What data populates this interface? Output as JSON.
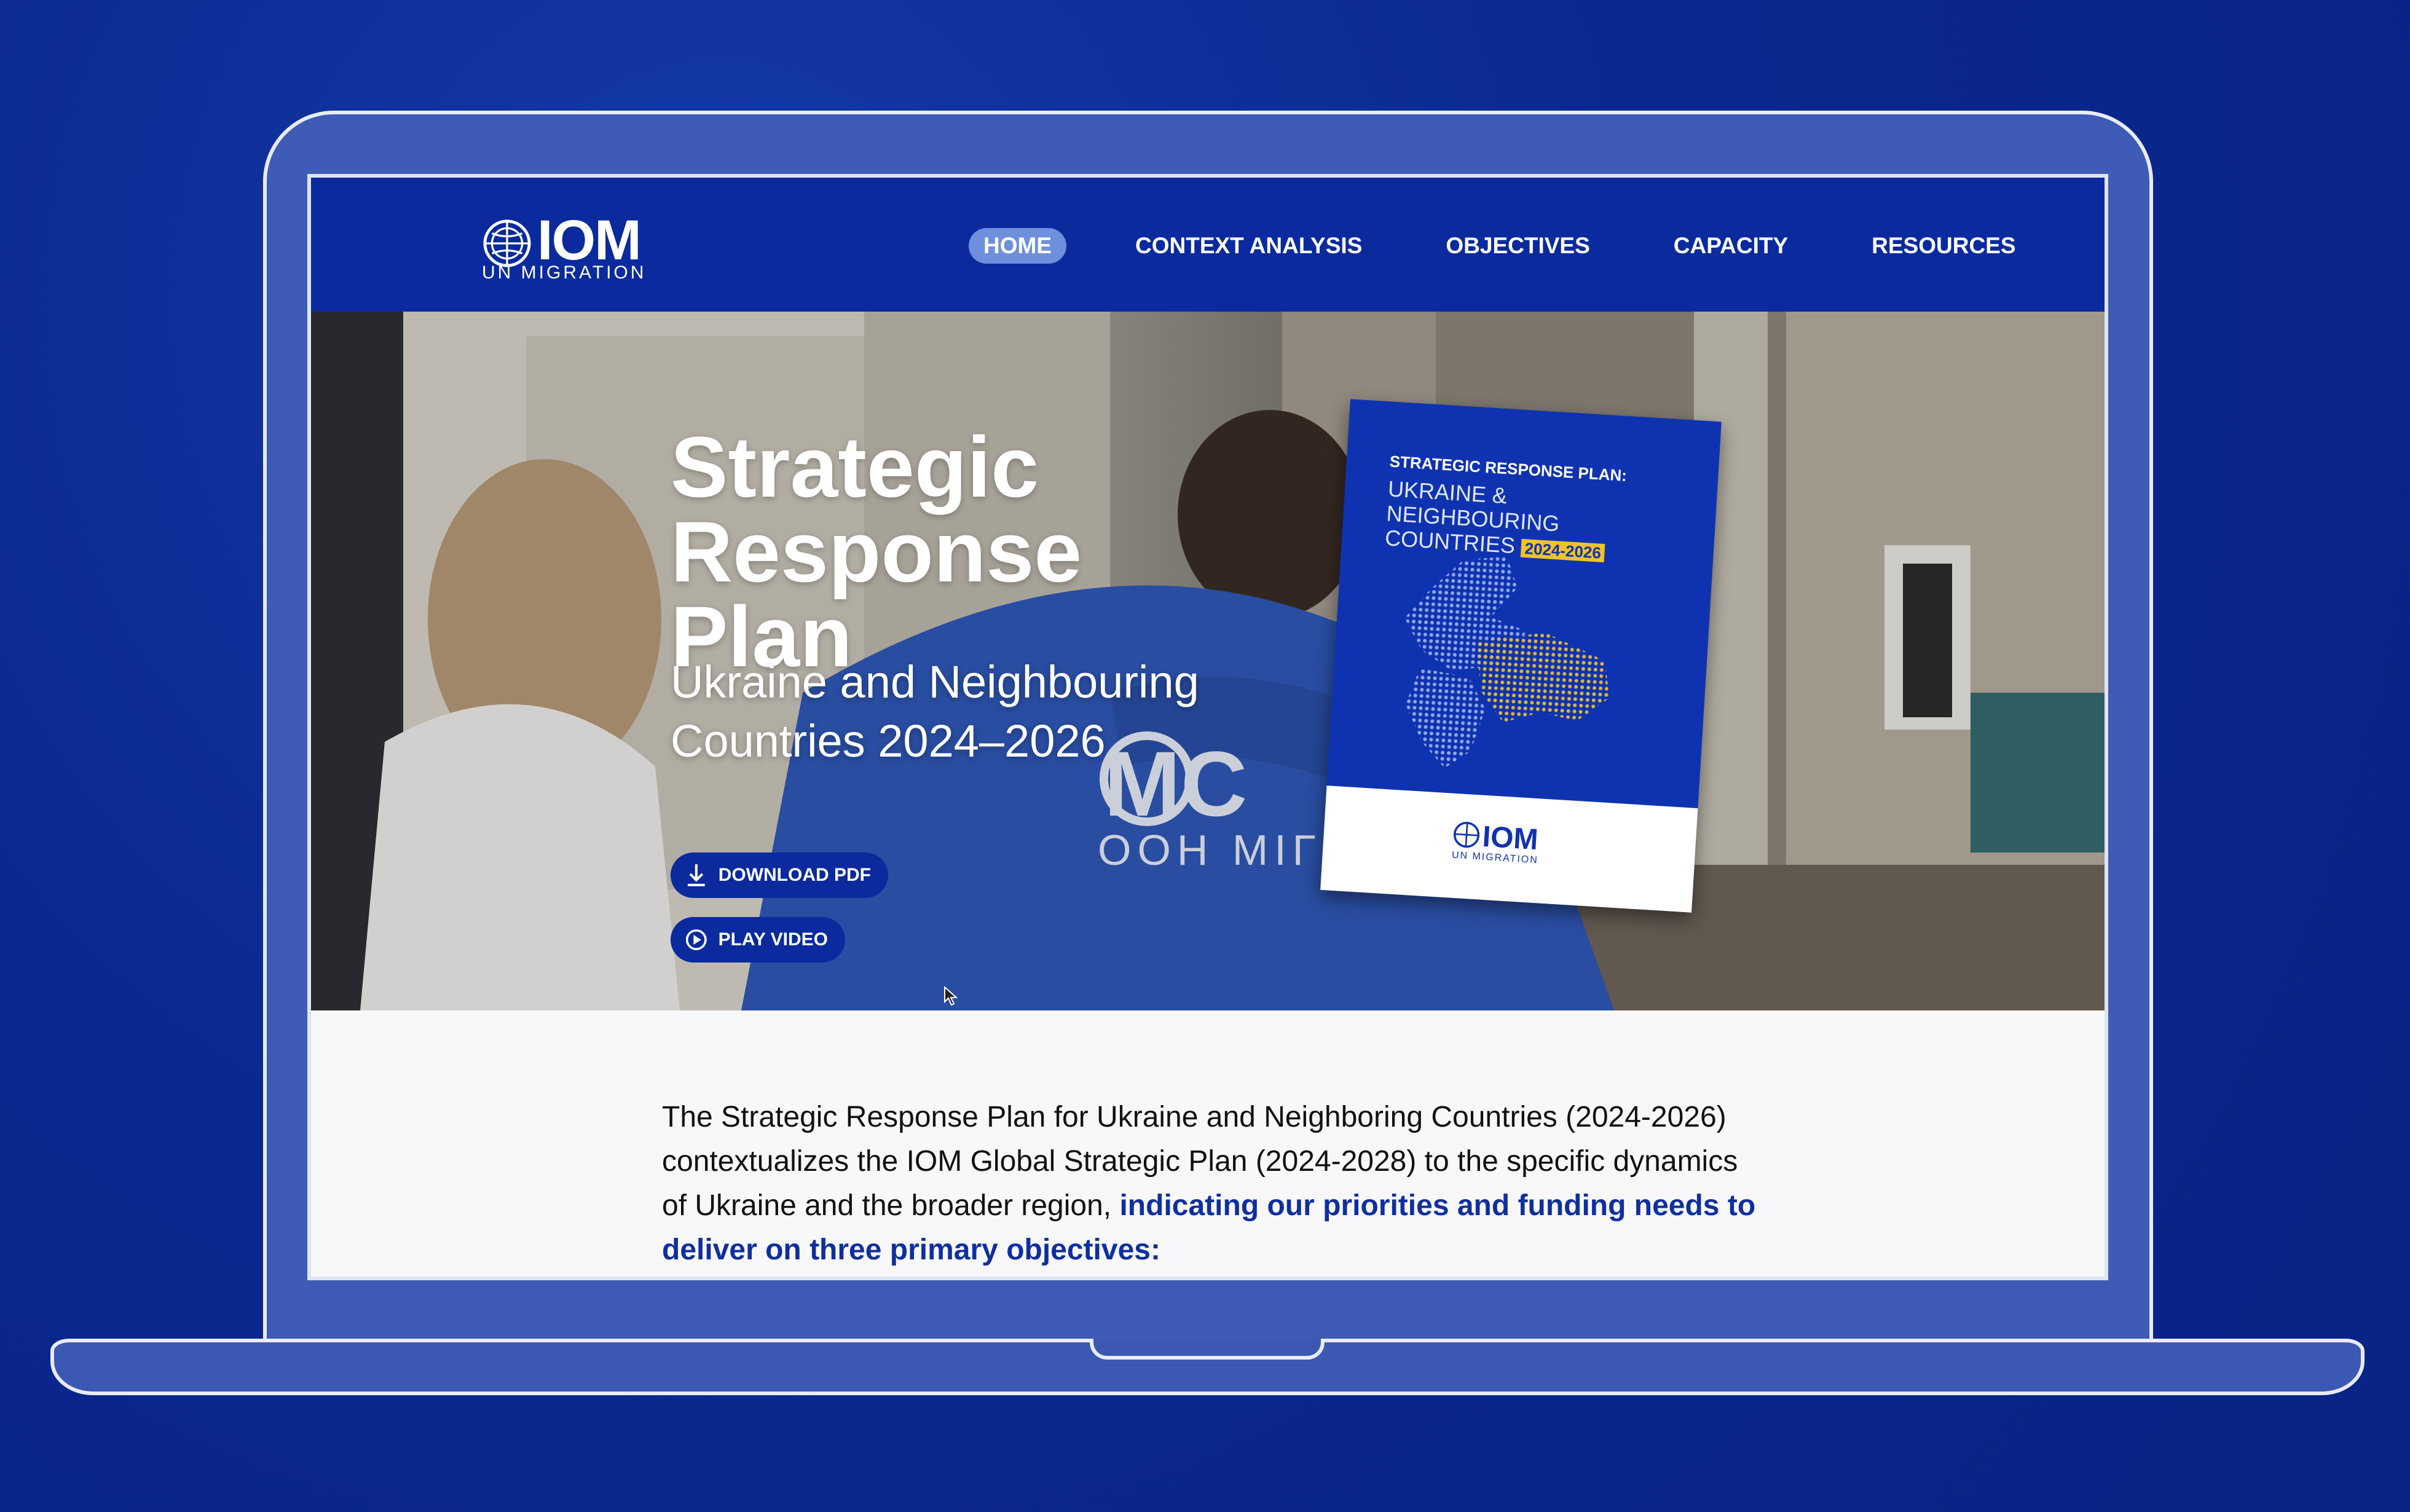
{
  "header": {
    "logo_text": "IOM",
    "logo_subtitle": "UN MIGRATION",
    "nav": [
      {
        "label": "HOME",
        "active": true
      },
      {
        "label": "CONTEXT ANALYSIS",
        "active": false
      },
      {
        "label": "OBJECTIVES",
        "active": false
      },
      {
        "label": "CAPACITY",
        "active": false
      },
      {
        "label": "RESOURCES",
        "active": false
      }
    ]
  },
  "hero": {
    "title": "Strategic Response Plan",
    "subtitle": "Ukraine and Neighbouring Countries 2024–2026",
    "download_label": "DOWNLOAD PDF",
    "video_label": "PLAY VIDEO",
    "cover": {
      "kicker": "STRATEGIC RESPONSE PLAN:",
      "title": "UKRAINE & NEIGHBOURING COUNTRIES",
      "years": "2024-2026",
      "logo_text": "IOM",
      "logo_subtitle": "UN MIGRATION"
    }
  },
  "intro": {
    "text": "The Strategic Response Plan for Ukraine and Neighboring Countries (2024-2026) contextualizes the IOM Global Strategic Plan (2024-2028) to the specific dynamics of Ukraine and the broader region, ",
    "highlight": "indicating our priorities and funding needs to deliver on three primary objectives:"
  },
  "colors": {
    "brand_blue": "#0a2a9e",
    "nav_active": "#6d8fdc",
    "highlight_text": "#0f2fa0",
    "accent_yellow": "#f0c22a"
  }
}
